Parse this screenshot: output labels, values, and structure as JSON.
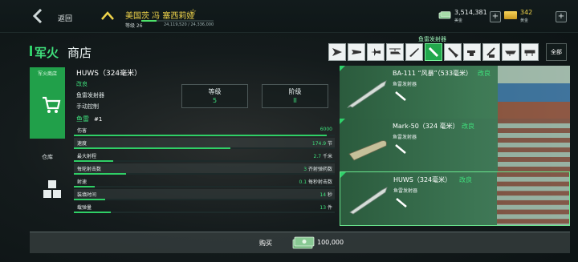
{
  "topbar": {
    "back_label": "返回",
    "player_name": "美国茨 冯 塞西莉娅",
    "level_label": "等级 26",
    "xp_progress": 0.21,
    "xp_text": "24,119,520 / 24,336,000",
    "cash_amount": "3,514,381",
    "cash_label": "美金",
    "gold_amount": "342",
    "gold_label": "黄金",
    "plus": "+"
  },
  "title": {
    "part1": "军火",
    "part2": "商店"
  },
  "category": {
    "selected_label": "鱼雷发射器",
    "tabs": [
      "fighter-icon",
      "bomber-icon",
      "attack-plane-icon",
      "helicopter-icon",
      "missile-icon",
      "torpedo-icon",
      "depth-charge-icon",
      "deck-gun-icon",
      "aa-gun-icon",
      "radar-icon",
      "launcher-icon"
    ],
    "selected_index": 5,
    "all_label": "全部"
  },
  "nav": {
    "shop_label": "军火商店",
    "depot_label": "仓库"
  },
  "weapon": {
    "name": "HUWS（324毫米）",
    "upgrade": "改良",
    "type": "鱼雷发射器",
    "control": "手动控制",
    "level_label": "等级",
    "level_value": "5",
    "tier_label": "阶级",
    "tier_value": "II",
    "torpedo_label": "鱼雷",
    "torpedo_num": "#1"
  },
  "stats": [
    {
      "name": "伤害",
      "value": "6000",
      "unit": "",
      "fill": 0.97
    },
    {
      "name": "速度",
      "value": "174.9",
      "unit": "节",
      "fill": 0.6
    },
    {
      "name": "最大射程",
      "value": "2.7",
      "unit": "千米",
      "fill": 0.15
    },
    {
      "name": "每轮射击数",
      "value": "3",
      "unit": "齐射弹药数",
      "fill": 0.2
    },
    {
      "name": "射速",
      "value": "0.1",
      "unit": "每秒射击数",
      "fill": 0.08
    },
    {
      "name": "装填时间",
      "value": "14",
      "unit": "秒",
      "fill": 0.12
    },
    {
      "name": "载弹量",
      "value": "13",
      "unit": "件",
      "fill": 0.14
    }
  ],
  "buy": {
    "label": "购买",
    "price": "100,000"
  },
  "items": [
    {
      "name": "BA-111 “风暴”（533毫米）",
      "badge": "改良",
      "type": "鱼雷发射器"
    },
    {
      "name": "Mark-50（324 毫米）",
      "badge": "改良",
      "type": "鱼雷发射器"
    },
    {
      "name": "HUWS（324毫米）",
      "badge": "改良",
      "type": "鱼雷发射器"
    }
  ],
  "colors": {
    "accent": "#2fd16a",
    "gold": "#f1d54b"
  }
}
